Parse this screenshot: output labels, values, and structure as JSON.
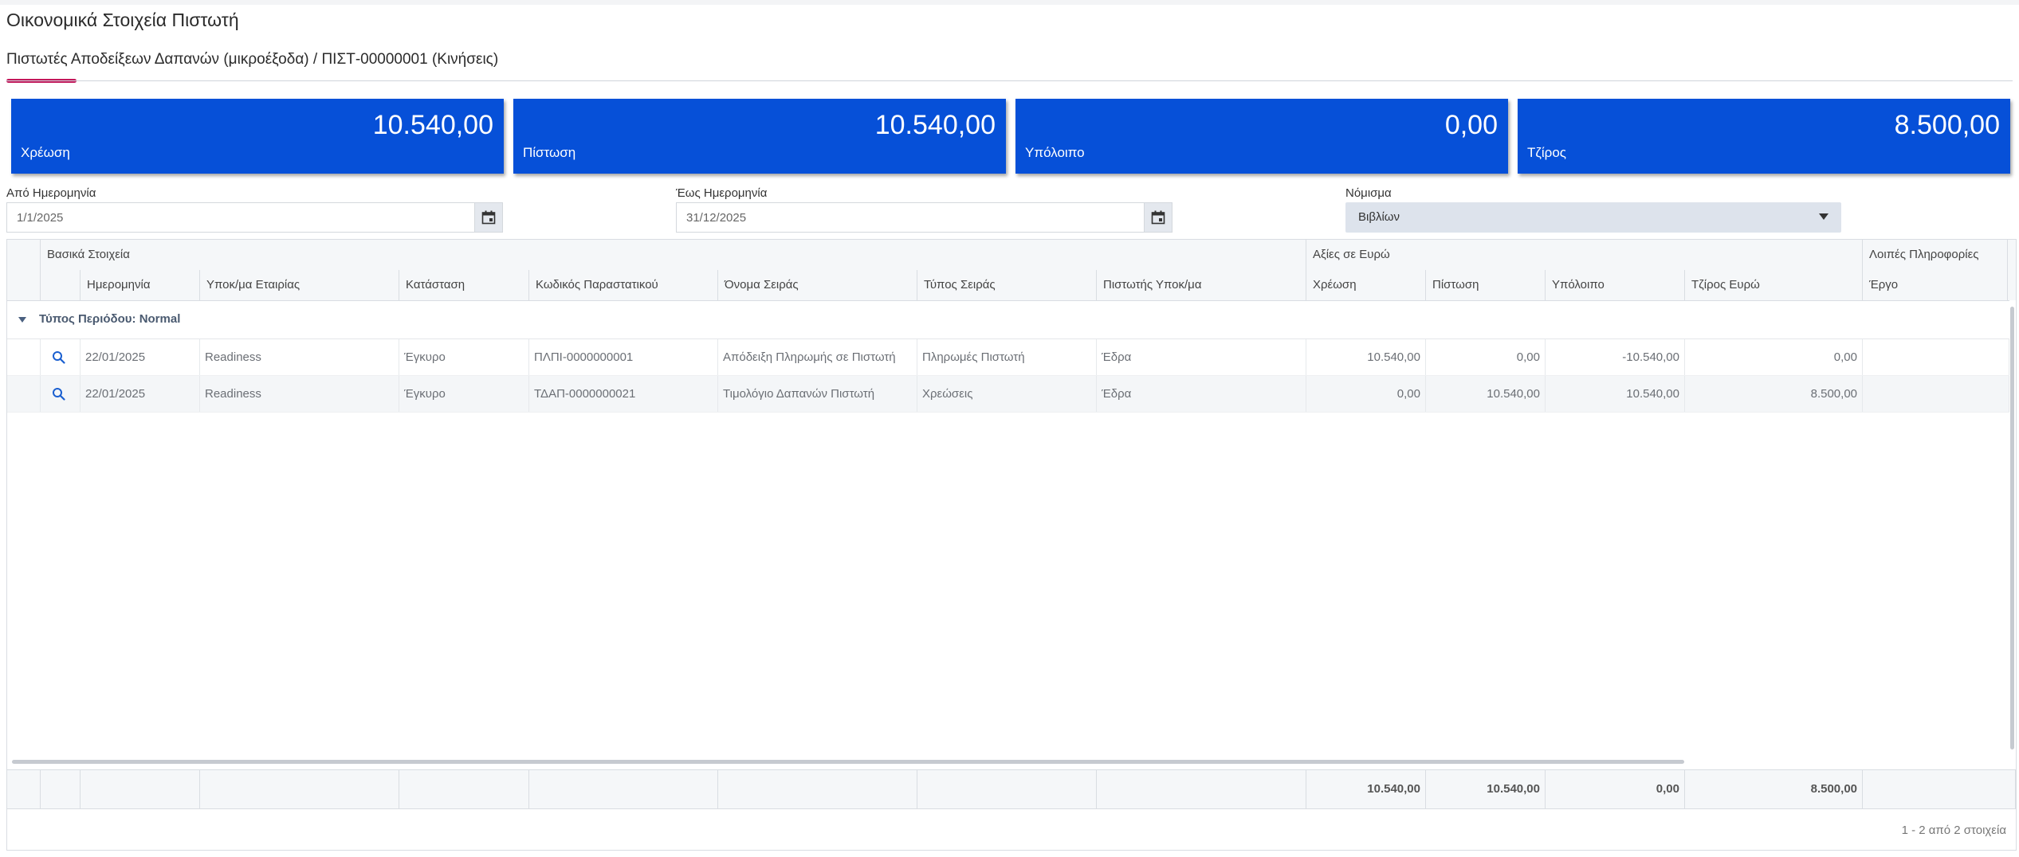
{
  "page": {
    "title": "Οικονομικά Στοιχεία Πιστωτή",
    "subtitle": "Πιστωτές Αποδείξεων Δαπανών (μικροέξοδα) / ΠΙΣΤ-00000001 (Κινήσεις)"
  },
  "cards": [
    {
      "value": "10.540,00",
      "label": "Χρέωση"
    },
    {
      "value": "10.540,00",
      "label": "Πίστωση"
    },
    {
      "value": "0,00",
      "label": "Υπόλοιπο"
    },
    {
      "value": "8.500,00",
      "label": "Τζίρος"
    }
  ],
  "filters": {
    "from_label": "Από Ημερομηνία",
    "from_value": "1/1/2025",
    "to_label": "Έως Ημερομηνία",
    "to_value": "31/12/2025",
    "currency_label": "Νόμισμα",
    "currency_value": "Βιβλίων"
  },
  "colors": {
    "card_bg": "#0650d8",
    "accent": "#c2185b"
  },
  "grid": {
    "groups": {
      "basic": "Βασικά Στοιχεία",
      "euro": "Αξίες σε Ευρώ",
      "other": "Λοιπές Πληροφορίες"
    },
    "columns": [
      "Ημερομηνία",
      "Υποκ/μα Εταιρίας",
      "Κατάσταση",
      "Κωδικός Παραστατικού",
      "Όνομα Σειράς",
      "Τύπος Σειράς",
      "Πιστωτής Υποκ/μα",
      "Χρέωση",
      "Πίστωση",
      "Υπόλοιπο",
      "Τζίρος Ευρώ",
      "Έργο"
    ],
    "group_row": "Τύπος Περιόδου: Normal",
    "rows": [
      [
        "22/01/2025",
        "Readiness",
        "Έγκυρο",
        "ΠΛΠΙ-0000000001",
        "Απόδειξη Πληρωμής σε Πιστωτή",
        "Πληρωμές Πιστωτή",
        "Έδρα",
        "10.540,00",
        "0,00",
        "-10.540,00",
        "0,00",
        ""
      ],
      [
        "22/01/2025",
        "Readiness",
        "Έγκυρο",
        "ΤΔΑΠ-0000000021",
        "Τιμολόγιο Δαπανών Πιστωτή",
        "Χρεώσεις",
        "Έδρα",
        "0,00",
        "10.540,00",
        "10.540,00",
        "8.500,00",
        ""
      ]
    ],
    "totals": {
      "debit": "10.540,00",
      "credit": "10.540,00",
      "balance": "0,00",
      "turnover": "8.500,00"
    },
    "pager": "1 - 2 από 2 στοιχεία"
  }
}
